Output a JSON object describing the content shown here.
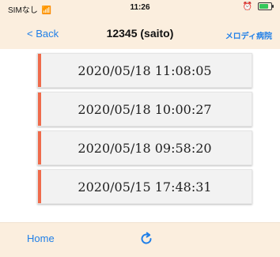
{
  "status_bar": {
    "carrier": "SIMなし",
    "time": "11:26"
  },
  "nav": {
    "back_label": "< Back",
    "title": "12345 (saito)",
    "right_label": "メロディ病院"
  },
  "records": [
    {
      "datetime": "2020/05/18 11:08:05"
    },
    {
      "datetime": "2020/05/18 10:00:27"
    },
    {
      "datetime": "2020/05/18 09:58:20"
    },
    {
      "datetime": "2020/05/15 17:48:31"
    }
  ],
  "bottom": {
    "home_label": "Home"
  },
  "icons": {
    "wifi": "wifi-icon",
    "alarm": "alarm-icon",
    "battery": "battery-icon",
    "refresh": "refresh-icon"
  },
  "colors": {
    "bar_bg": "#fbeede",
    "link": "#1f7fe8",
    "accent": "#ef6b4b"
  }
}
